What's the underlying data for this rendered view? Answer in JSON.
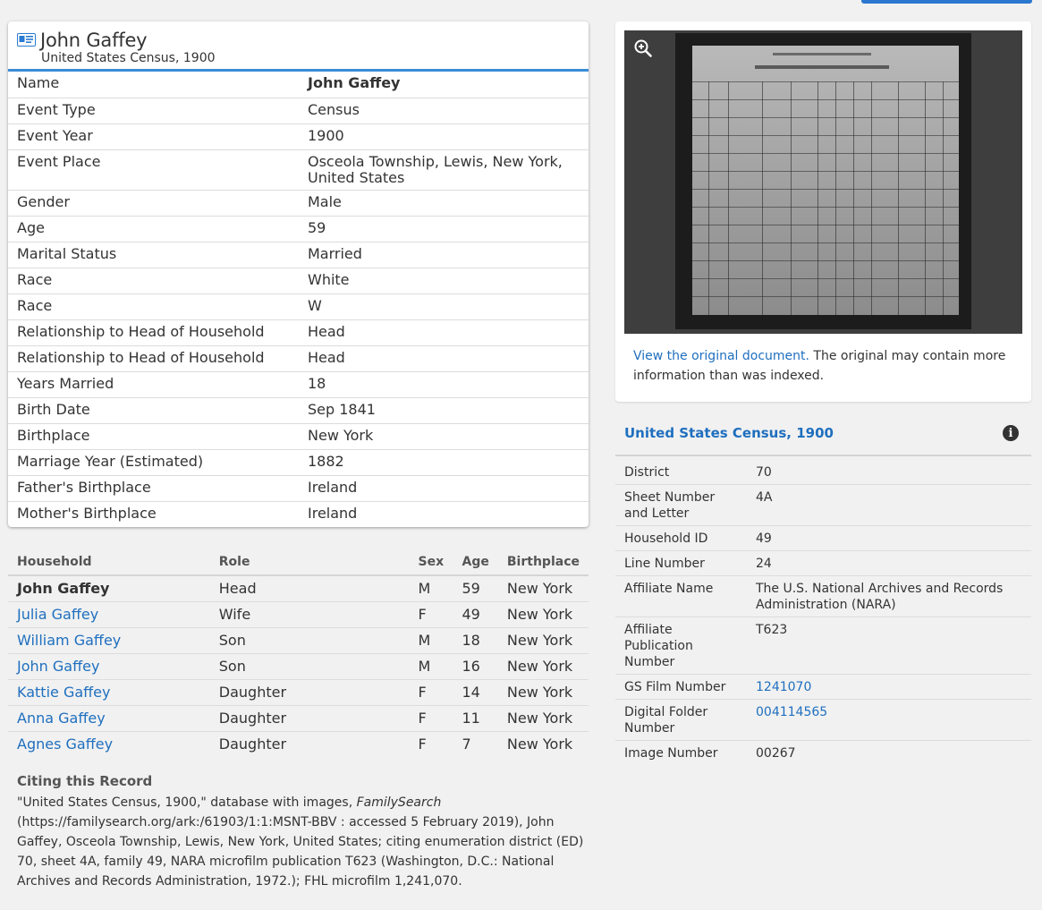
{
  "record": {
    "name": "John Gaffey",
    "collection": "United States Census, 1900",
    "facts": [
      {
        "label": "Name",
        "value": "John Gaffey",
        "bold": true
      },
      {
        "label": "Event Type",
        "value": "Census"
      },
      {
        "label": "Event Year",
        "value": "1900"
      },
      {
        "label": "Event Place",
        "value": "Osceola Township, Lewis, New York, United States"
      },
      {
        "label": "Gender",
        "value": "Male"
      },
      {
        "label": "Age",
        "value": "59"
      },
      {
        "label": "Marital Status",
        "value": "Married"
      },
      {
        "label": "Race",
        "value": "White"
      },
      {
        "label": "Race",
        "value": "W"
      },
      {
        "label": "Relationship to Head of Household",
        "value": "Head"
      },
      {
        "label": "Relationship to Head of Household",
        "value": "Head"
      },
      {
        "label": "Years Married",
        "value": "18"
      },
      {
        "label": "Birth Date",
        "value": "Sep 1841"
      },
      {
        "label": "Birthplace",
        "value": "New York"
      },
      {
        "label": "Marriage Year (Estimated)",
        "value": "1882"
      },
      {
        "label": "Father's Birthplace",
        "value": "Ireland"
      },
      {
        "label": "Mother's Birthplace",
        "value": "Ireland"
      }
    ]
  },
  "household": {
    "headers": {
      "household": "Household",
      "role": "Role",
      "sex": "Sex",
      "age": "Age",
      "birthplace": "Birthplace"
    },
    "members": [
      {
        "name": "John Gaffey",
        "role": "Head",
        "sex": "M",
        "age": "59",
        "birthplace": "New York",
        "current": true
      },
      {
        "name": "Julia Gaffey",
        "role": "Wife",
        "sex": "F",
        "age": "49",
        "birthplace": "New York"
      },
      {
        "name": "William Gaffey",
        "role": "Son",
        "sex": "M",
        "age": "18",
        "birthplace": "New York"
      },
      {
        "name": "John Gaffey",
        "role": "Son",
        "sex": "M",
        "age": "16",
        "birthplace": "New York"
      },
      {
        "name": "Kattie Gaffey",
        "role": "Daughter",
        "sex": "F",
        "age": "14",
        "birthplace": "New York"
      },
      {
        "name": "Anna Gaffey",
        "role": "Daughter",
        "sex": "F",
        "age": "11",
        "birthplace": "New York"
      },
      {
        "name": "Agnes Gaffey",
        "role": "Daughter",
        "sex": "F",
        "age": "7",
        "birthplace": "New York"
      }
    ]
  },
  "citing": {
    "title": "Citing this Record",
    "text_before": "\"United States Census, 1900,\" database with images, ",
    "text_italic": "FamilySearch",
    "text_after": " (https://familysearch.org/ark:/61903/1:1:MSNT-BBV : accessed 5 February 2019), John Gaffey, Osceola Township, Lewis, New York, United States; citing enumeration district (ED) 70, sheet 4A, family 49, NARA microfilm publication T623 (Washington, D.C.: National Archives and Records Administration, 1972.); FHL microfilm 1,241,070."
  },
  "image_panel": {
    "link_text": "View the original document.",
    "note_text": " The original may contain more information than was indexed."
  },
  "source": {
    "title": "United States Census, 1900",
    "rows": [
      {
        "label": "District",
        "value": "70"
      },
      {
        "label": "Sheet Number and Letter",
        "value": "4A"
      },
      {
        "label": "Household ID",
        "value": "49"
      },
      {
        "label": "Line Number",
        "value": "24"
      },
      {
        "label": "Affiliate Name",
        "value": "The U.S. National Archives and Records Administration (NARA)"
      },
      {
        "label": "Affiliate Publication Number",
        "value": "T623"
      },
      {
        "label": "GS Film Number",
        "value": "1241070",
        "link": true
      },
      {
        "label": "Digital Folder Number",
        "value": "004114565",
        "link": true
      },
      {
        "label": "Image Number",
        "value": "00267"
      }
    ]
  },
  "colors": {
    "accent": "#3a8bd6",
    "link": "#1f6fbf"
  },
  "icons": [
    "record-card-icon",
    "zoom-in-icon",
    "info-icon"
  ]
}
